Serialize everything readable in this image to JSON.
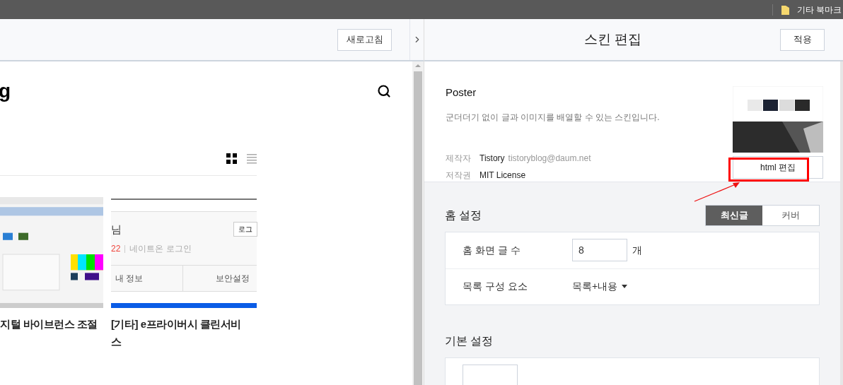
{
  "browser_bar": {
    "bookmark_folder": "기타 북마크"
  },
  "preview": {
    "refresh_button": "새로고침",
    "blog_title": "g",
    "view_modes": [
      {
        "kind": "grid",
        "selected": true
      },
      {
        "kind": "list",
        "selected": false
      }
    ],
    "posts": [
      {
        "title": "지털 바이브런스 조절"
      },
      {
        "title": "[기타] e프라이버시 클린서비스",
        "thumbnail": {
          "kind": "screenshot",
          "name": "님",
          "count": "22",
          "link": "네이트온 로그인",
          "button": "로그",
          "tabs": [
            "내 정보",
            "보안설정"
          ]
        }
      }
    ]
  },
  "editor": {
    "title": "스킨 편집",
    "apply_button": "적용",
    "skin": {
      "name": "Poster",
      "description": "군더더기 없이 글과 이미지를 배열할 수 있는 스킨입니다.",
      "meta": [
        {
          "label": "제작자",
          "value": "Tistory",
          "extra": "tistoryblog@daum.net"
        },
        {
          "label": "저작권",
          "value": "MIT License"
        }
      ],
      "edit_button": "html 편집"
    },
    "annotation": {
      "highlight": true
    },
    "sections": [
      {
        "title": "홈 설정",
        "modes": [
          {
            "label": "최신글",
            "selected": true
          },
          {
            "label": "커버",
            "selected": false
          }
        ],
        "rows": [
          {
            "kind": "number",
            "label": "홈 화면 글 수",
            "value": "8",
            "unit": "개"
          },
          {
            "kind": "select",
            "label": "목록 구성 요소",
            "value": "목록+내용"
          }
        ]
      },
      {
        "title": "기본 설정",
        "rows": [
          {
            "kind": "number"
          }
        ]
      }
    ]
  }
}
